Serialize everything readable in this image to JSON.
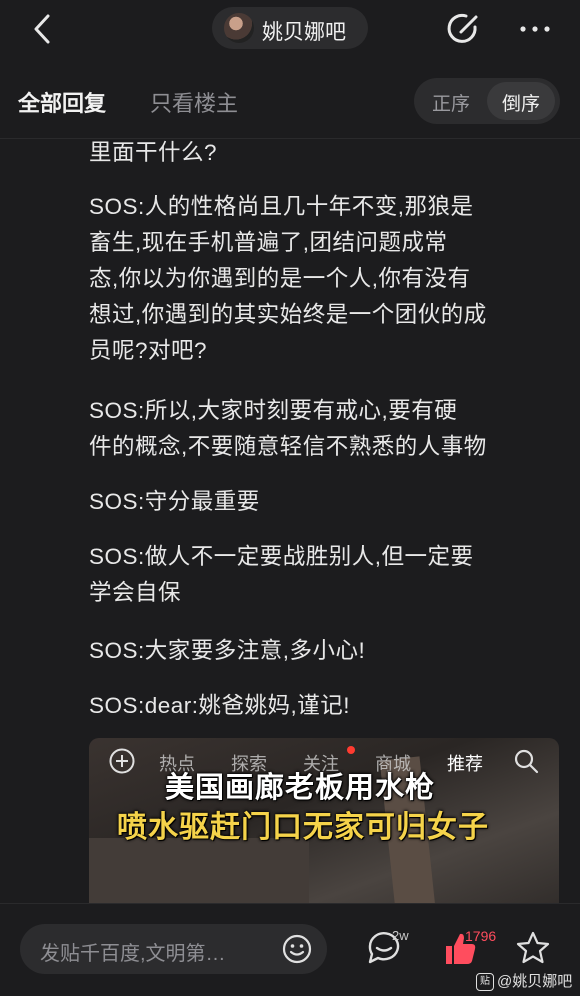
{
  "header": {
    "forum_name": "姚贝娜吧"
  },
  "tabs": {
    "all_replies": "全部回复",
    "only_op": "只看楼主",
    "order_asc": "正序",
    "order_desc": "倒序"
  },
  "post": {
    "paragraphs": [
      [
        "里面干什么?"
      ],
      [
        "SOS:人的性格尚且几十年不变,那狼是",
        "畜生,现在手机普遍了,团结问题成常",
        "态,你以为你遇到的是一个人,你有没有",
        "想过,你遇到的其实始终是一个团伙的成",
        "员呢?对吧?"
      ],
      [
        "SOS:所以,大家时刻要有戒心,要有硬",
        "件的概念,不要随意轻信不熟悉的人事物"
      ],
      [
        "SOS:守分最重要"
      ],
      [
        "SOS:做人不一定要战胜别人,但一定要",
        "学会自保"
      ],
      [
        "SOS:大家要多注意,多小心!"
      ],
      [
        "SOS:dear:姚爸姚妈,谨记!"
      ]
    ]
  },
  "video": {
    "nav_items": [
      "热点",
      "探索",
      "关注",
      "商城",
      "推荐"
    ],
    "caption_line1": "美国画廊老板用水枪",
    "caption_line2": "喷水驱赶门口无家可归女子"
  },
  "bottom": {
    "input_placeholder": "发贴千百度,文明第…",
    "comment_count": "2w",
    "like_count": "1796",
    "watermark": "@姚贝娜吧"
  },
  "colors": {
    "background": "#1c1c1e",
    "accent_like": "#ff4d5e",
    "caption_yellow": "#f5d34a"
  }
}
